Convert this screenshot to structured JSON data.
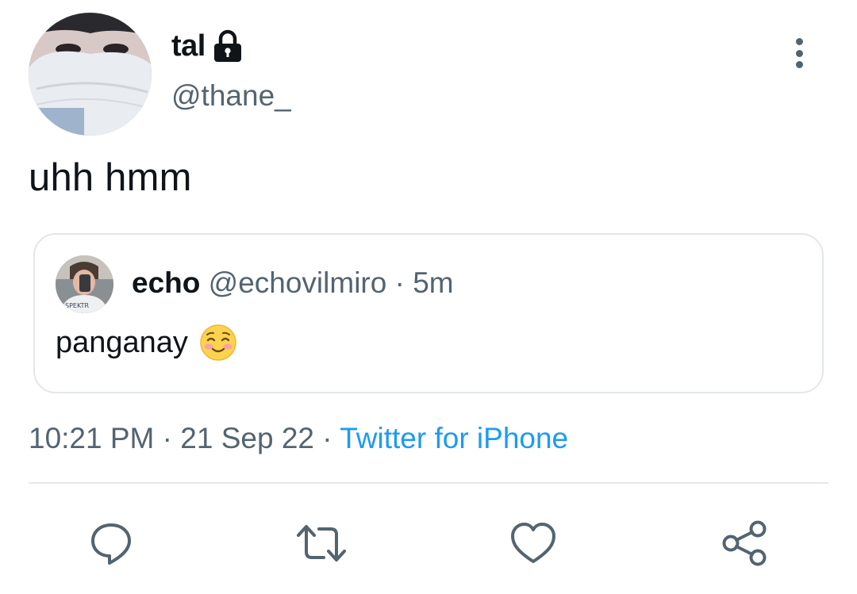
{
  "author": {
    "display_name": "tal",
    "handle": "@thane_"
  },
  "tweet": {
    "text": "uhh hmm"
  },
  "quoted_tweet": {
    "name": "echo",
    "handle": "@echovilmiro",
    "separator": "·",
    "time": "5m",
    "text": "panganay"
  },
  "meta": {
    "time": "10:21 PM",
    "sep1": "·",
    "date": "21 Sep 22",
    "sep2": "·",
    "source": "Twitter for iPhone"
  },
  "icons": {
    "lock": "lock-icon",
    "more": "more-vertical-icon",
    "reply": "reply-icon",
    "retweet": "retweet-icon",
    "like": "heart-icon",
    "share": "share-icon",
    "emoji": "smiling-face-with-blush-emoji"
  },
  "colors": {
    "text_primary": "#0f1419",
    "text_secondary": "#536471",
    "link": "#1d9bf0",
    "border": "#e3e7ea"
  }
}
